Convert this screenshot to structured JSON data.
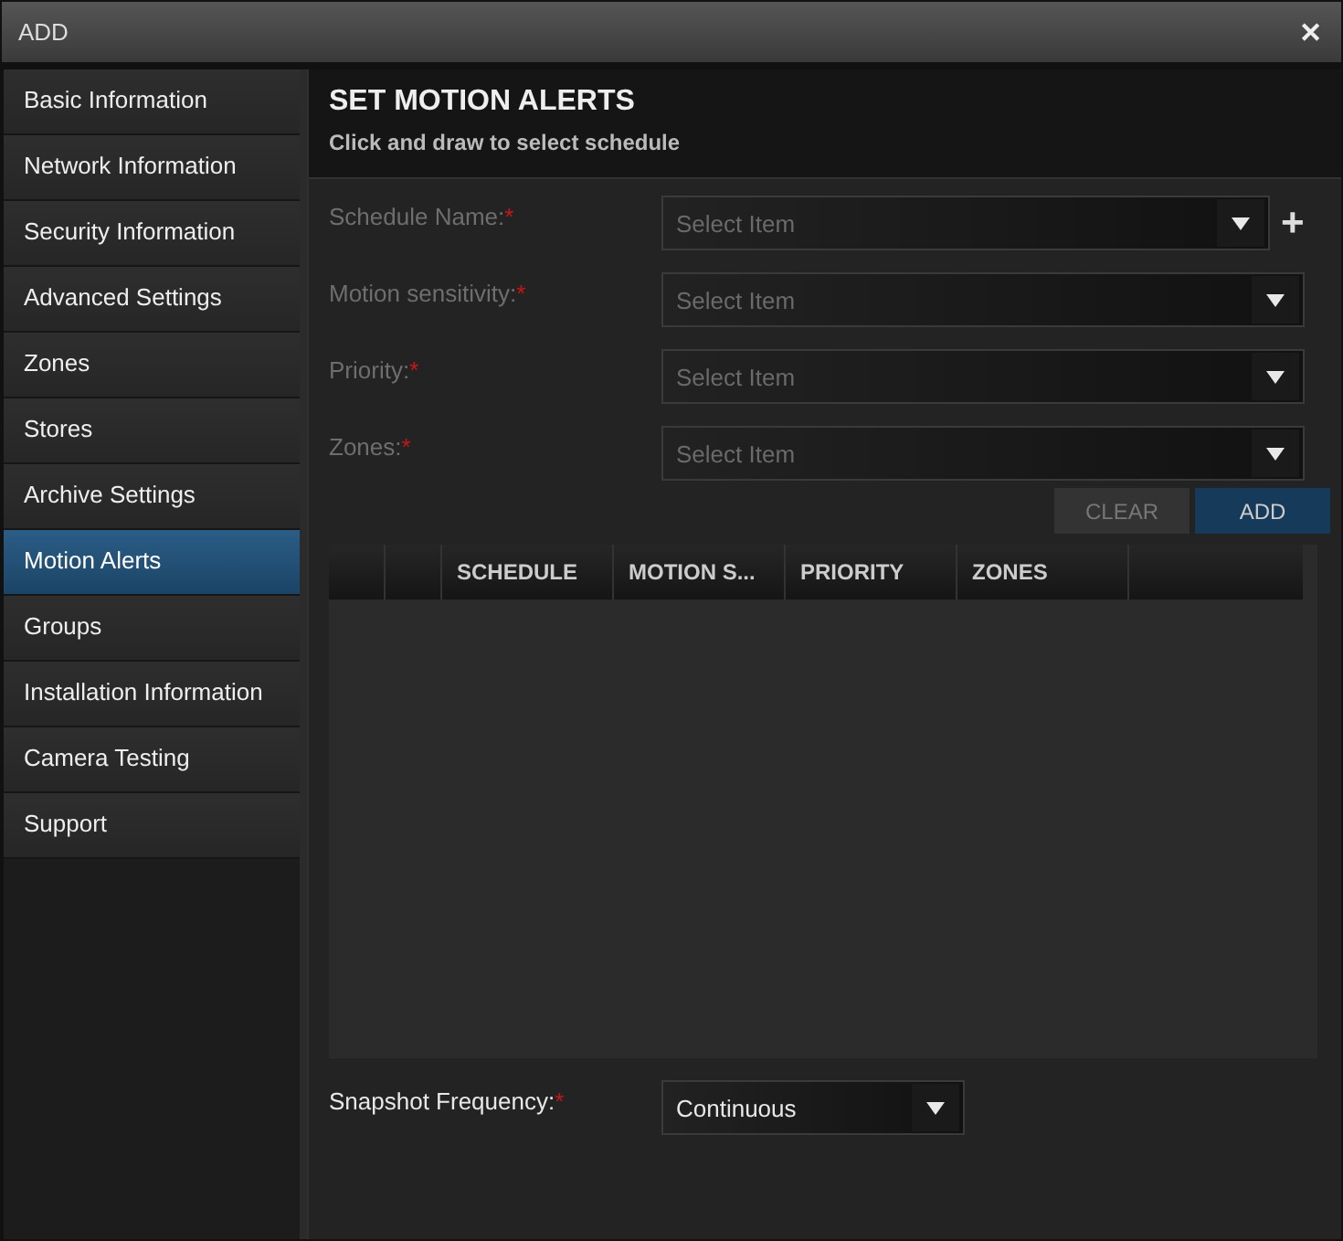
{
  "window": {
    "title": "ADD",
    "close": "✕"
  },
  "sidebar": {
    "items": [
      {
        "label": "Basic Information",
        "selected": false
      },
      {
        "label": "Network Information",
        "selected": false
      },
      {
        "label": "Security Information",
        "selected": false
      },
      {
        "label": "Advanced Settings",
        "selected": false
      },
      {
        "label": "Zones",
        "selected": false
      },
      {
        "label": "Stores",
        "selected": false
      },
      {
        "label": "Archive Settings",
        "selected": false
      },
      {
        "label": "Motion Alerts",
        "selected": true
      },
      {
        "label": "Groups",
        "selected": false
      },
      {
        "label": "Installation Information",
        "selected": false
      },
      {
        "label": "Camera Testing",
        "selected": false
      },
      {
        "label": "Support",
        "selected": false
      }
    ]
  },
  "header": {
    "title": "SET MOTION ALERTS",
    "subtitle": "Click and draw to select schedule"
  },
  "form": {
    "fields": [
      {
        "label": "Schedule Name:",
        "required": "*",
        "placeholder": "Select Item",
        "disabled": true,
        "add": "+"
      },
      {
        "label": "Motion sensitivity:",
        "required": "*",
        "placeholder": "Select Item",
        "disabled": true
      },
      {
        "label": "Priority:",
        "required": "*",
        "placeholder": "Select Item",
        "disabled": true
      },
      {
        "label": "Zones:",
        "required": "*",
        "placeholder": "Select Item",
        "disabled": true
      }
    ],
    "buttons": [
      {
        "label": "CLEAR",
        "kind": "secondary",
        "disabled": true
      },
      {
        "label": "ADD",
        "kind": "primary",
        "disabled": false
      }
    ]
  },
  "table": {
    "columns": [
      null,
      null,
      "SCHEDULE",
      "MOTION S...",
      "PRIORITY",
      "ZONES",
      null
    ]
  },
  "snapshot": {
    "label": "Snapshot Frequency:",
    "required": "*",
    "value": "Continuous",
    "disabled": false
  }
}
